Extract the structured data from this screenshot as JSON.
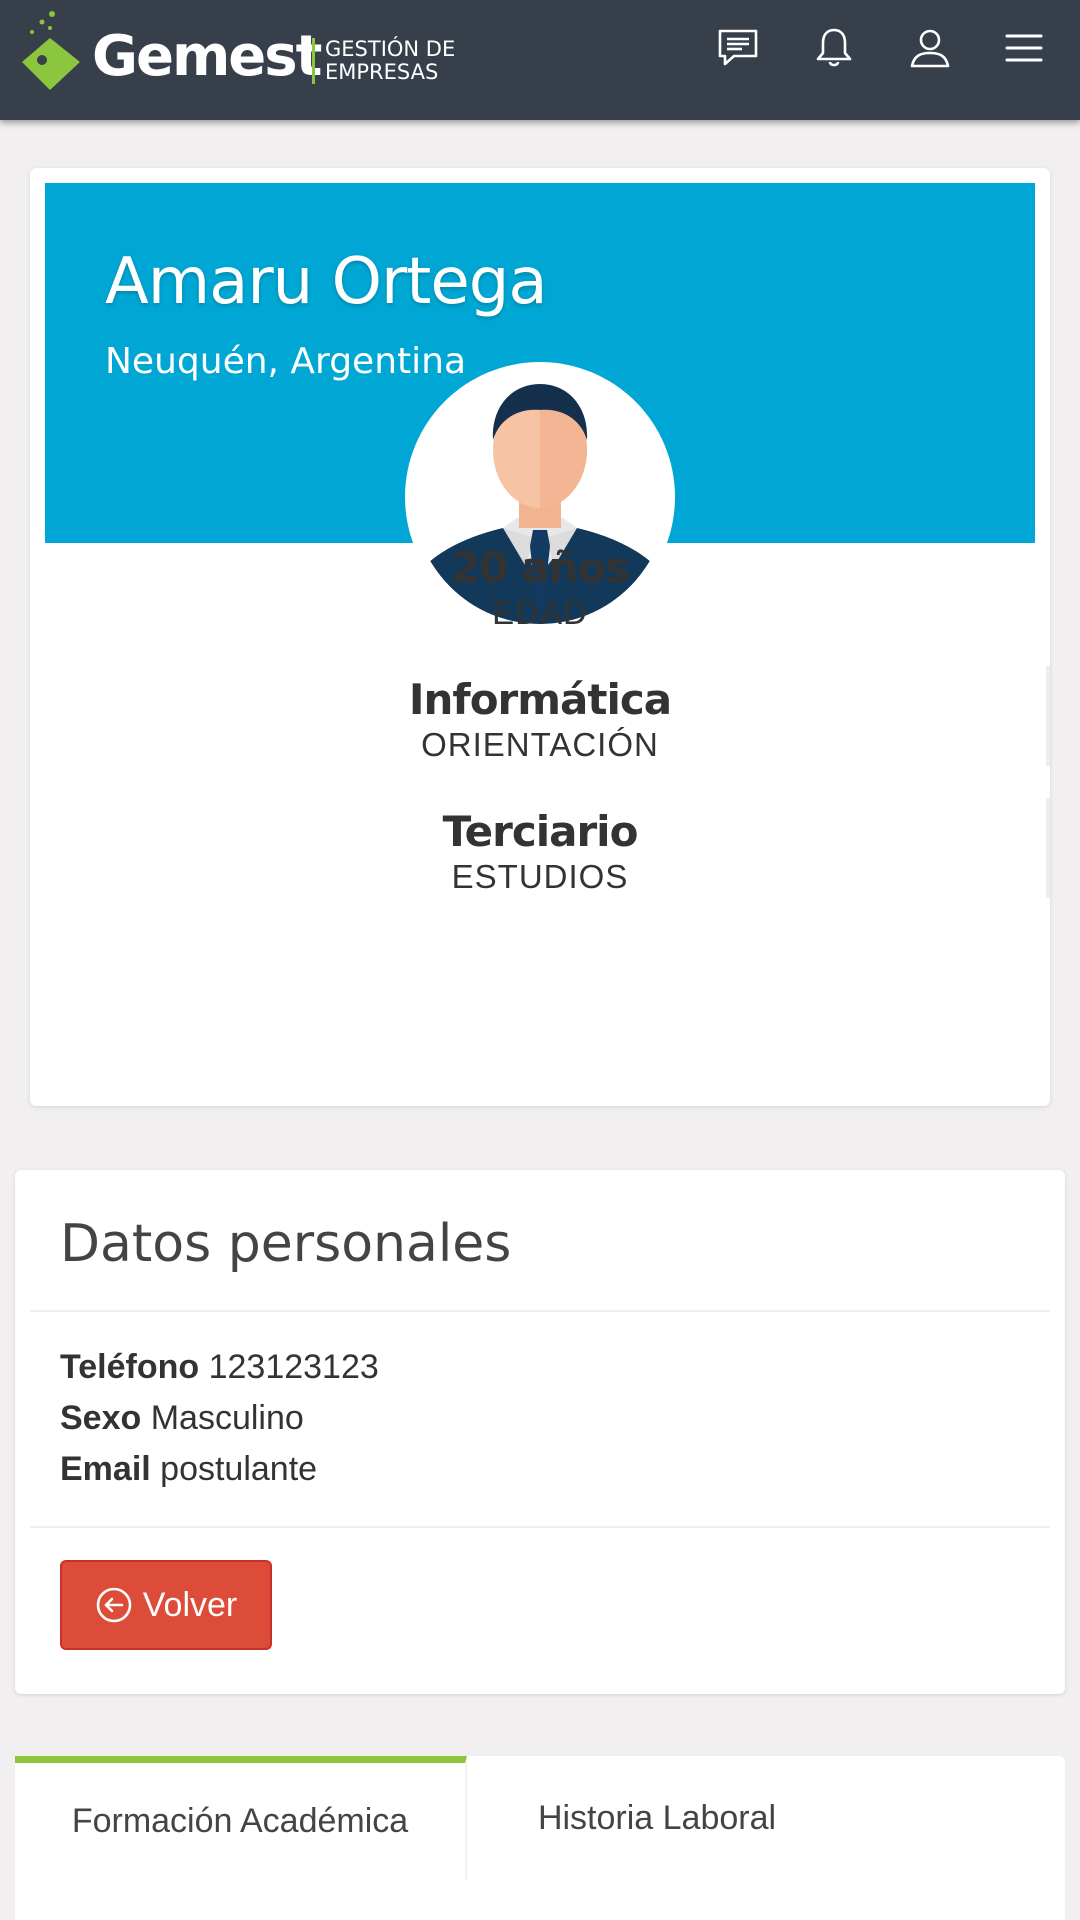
{
  "header": {
    "logo_word": "Gemest",
    "logo_sub_line1": "GESTIÓN DE",
    "logo_sub_line2": "EMPRESAS",
    "icons": [
      "messages-icon",
      "bell-icon",
      "user-icon",
      "menu-icon"
    ]
  },
  "profile": {
    "name": "Amaru Ortega",
    "location": "Neuquén, Argentina",
    "banner_color": "#00a7d4",
    "stats": [
      {
        "value": "20 años",
        "label": "EDAD"
      },
      {
        "value": "Informática",
        "label": "ORIENTACIÓN"
      },
      {
        "value": "Terciario",
        "label": "ESTUDIOS"
      }
    ]
  },
  "personal": {
    "title": "Datos personales",
    "phone_label": "Teléfono",
    "phone_value": "123123123",
    "sex_label": "Sexo",
    "sex_value": "Masculino",
    "email_label": "Email",
    "email_value": "postulante",
    "back_button": "Volver",
    "back_button_color": "#dd4b39"
  },
  "tabs": [
    {
      "label": "Formación Académica",
      "active": true
    },
    {
      "label": "Historia Laboral",
      "active": false
    }
  ],
  "colors": {
    "header_bg": "#37404a",
    "accent_green": "#8cc63f",
    "page_bg": "#f1efef"
  }
}
